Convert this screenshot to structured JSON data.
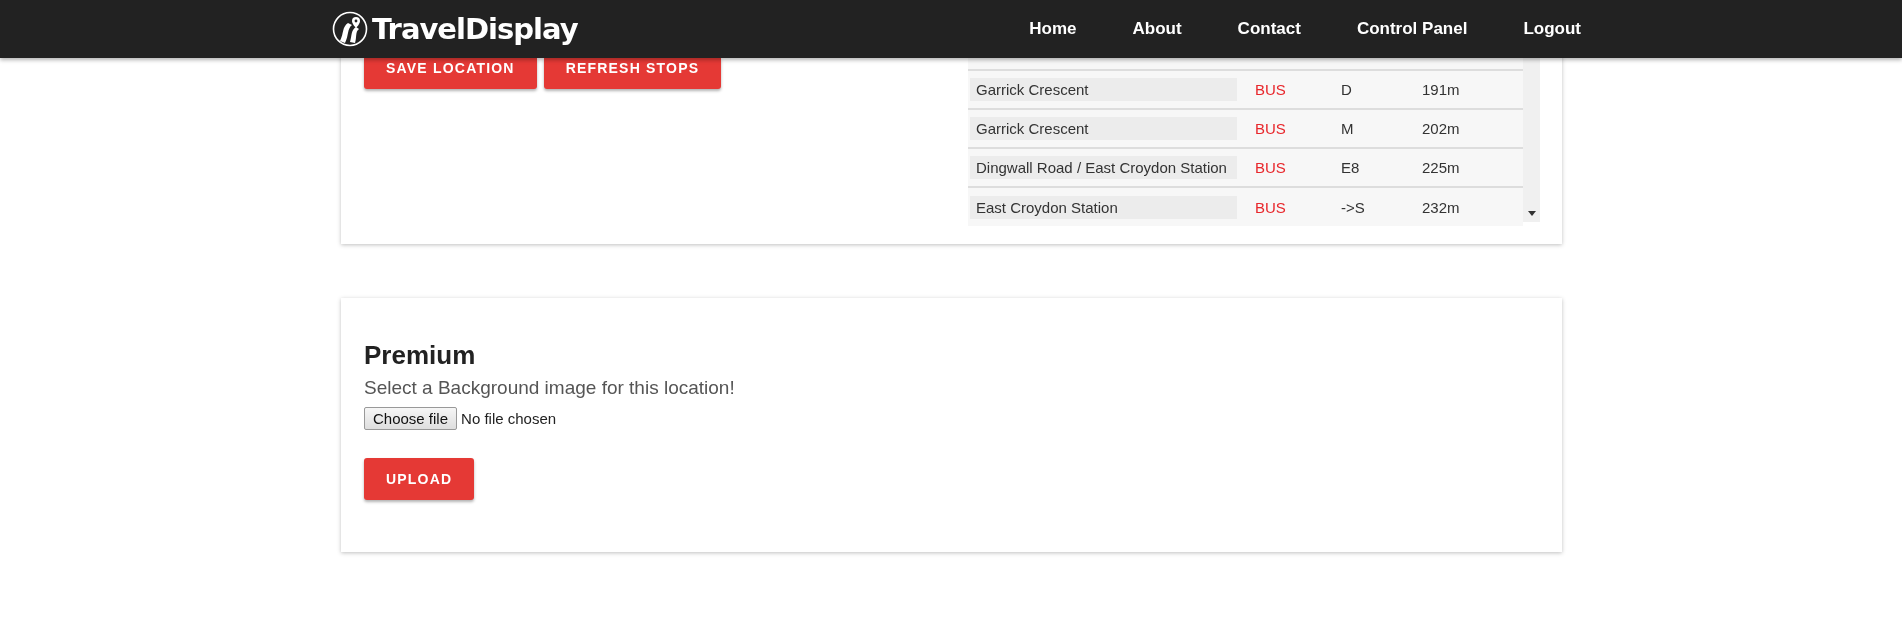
{
  "header": {
    "brand": "TravelDisplay",
    "nav": [
      {
        "label": "Home"
      },
      {
        "label": "About"
      },
      {
        "label": "Contact"
      },
      {
        "label": "Control Panel"
      },
      {
        "label": "Logout"
      }
    ]
  },
  "location_card": {
    "buttons": [
      "SAVE LOCATION",
      "REFRESH STOPS"
    ],
    "stops": [
      {
        "name": "Garrick Crescent",
        "mode": "BUS",
        "route": "D",
        "distance": "191m"
      },
      {
        "name": "Garrick Crescent",
        "mode": "BUS",
        "route": "M",
        "distance": "202m"
      },
      {
        "name": "Dingwall Road / East Croydon Station",
        "mode": "BUS",
        "route": "E8",
        "distance": "225m"
      },
      {
        "name": "East Croydon Station",
        "mode": "BUS",
        "route": "->S",
        "distance": "232m"
      }
    ]
  },
  "premium_card": {
    "title": "Premium",
    "description": "Select a Background image for this location!",
    "file_button": "Choose file",
    "file_status": "No file chosen",
    "upload_button": "UPLOAD"
  }
}
